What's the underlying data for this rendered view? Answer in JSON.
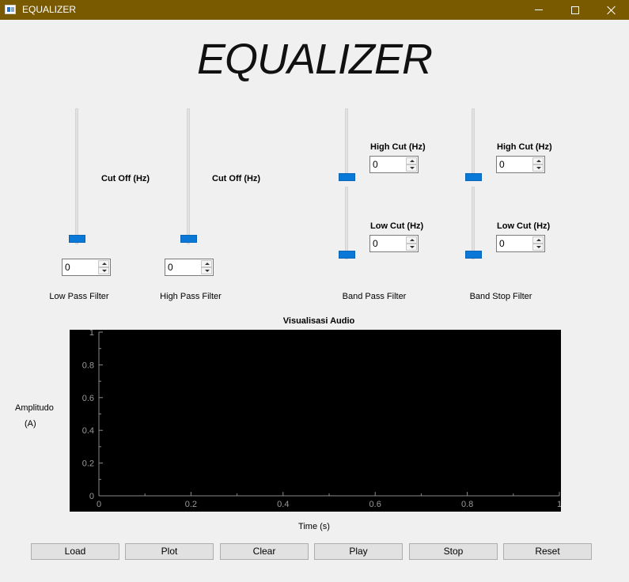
{
  "window": {
    "title": "EQUALIZER"
  },
  "heading": "EQUALIZER",
  "filters": {
    "low_pass": {
      "name": "Low Pass Filter",
      "cutoff_label": "Cut Off (Hz)",
      "value": "0"
    },
    "high_pass": {
      "name": "High Pass Filter",
      "cutoff_label": "Cut Off (Hz)",
      "value": "0"
    },
    "band_pass": {
      "name": "Band Pass Filter",
      "high_label": "High Cut (Hz)",
      "high_value": "0",
      "low_label": "Low Cut (Hz)",
      "low_value": "0"
    },
    "band_stop": {
      "name": "Band Stop Filter",
      "high_label": "High Cut (Hz)",
      "high_value": "0",
      "low_label": "Low Cut (Hz)",
      "low_value": "0"
    }
  },
  "chart_data": {
    "type": "line",
    "title": "Visualisasi Audio",
    "xlabel": "Time (s)",
    "ylabel_line1": "Amplitudo",
    "ylabel_line2": "(A)",
    "xlim": [
      0,
      1
    ],
    "ylim": [
      0,
      1
    ],
    "xticks": [
      "0",
      "0.2",
      "0.4",
      "0.6",
      "0.8",
      "1"
    ],
    "yticks": [
      "0",
      "0.2",
      "0.4",
      "0.6",
      "0.8",
      "1"
    ],
    "series": [],
    "background": "#000000"
  },
  "buttons": {
    "load": "Load",
    "plot": "Plot",
    "clear": "Clear",
    "play": "Play",
    "stop": "Stop",
    "reset": "Reset"
  },
  "colors": {
    "titlebar": "#7a5a00",
    "slider_handle": "#0a78d7",
    "plot_bg": "#000000"
  }
}
